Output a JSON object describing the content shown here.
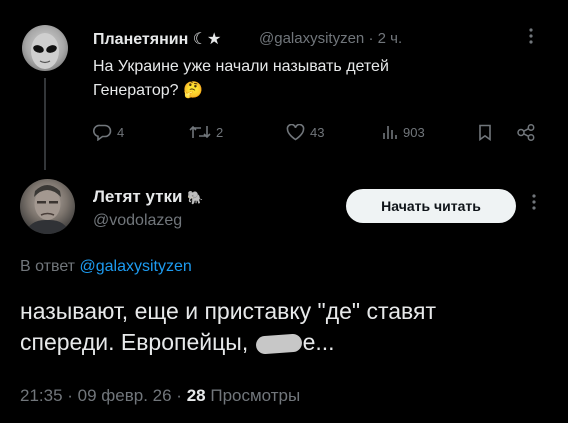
{
  "parent_tweet": {
    "author_name": "Планетянин",
    "author_badge": "☾★",
    "handle": "@galaxysityzen",
    "separator": "·",
    "time": "2 ч.",
    "text_line1": "На Украине уже начали называть детей",
    "text_line2": "Генератор?",
    "emoji": "🤔",
    "more_icon": "more-icon",
    "actions": {
      "replies": "4",
      "retweets": "2",
      "likes": "43",
      "views": "903"
    }
  },
  "tweet": {
    "author_name": "Летят утки",
    "author_emoji": "🐘",
    "handle": "@vodolazeg",
    "follow_label": "Начать читать",
    "reply_prefix": "В ответ",
    "reply_handle": "@galaxysityzen",
    "text_line1": "называют, еще и приставку \"де\" ставят",
    "text_line2_before": "спереди. Европейцы, ",
    "text_line2_after": "е...",
    "timestamp": "21:35 · 09 февр. 26 ·",
    "views_count": "28",
    "views_label": "Просмотры"
  },
  "colors": {
    "background": "#000000",
    "text": "#e7e9ea",
    "muted": "#71767b",
    "link": "#1d9bf0",
    "button_bg": "#eff3f4"
  }
}
